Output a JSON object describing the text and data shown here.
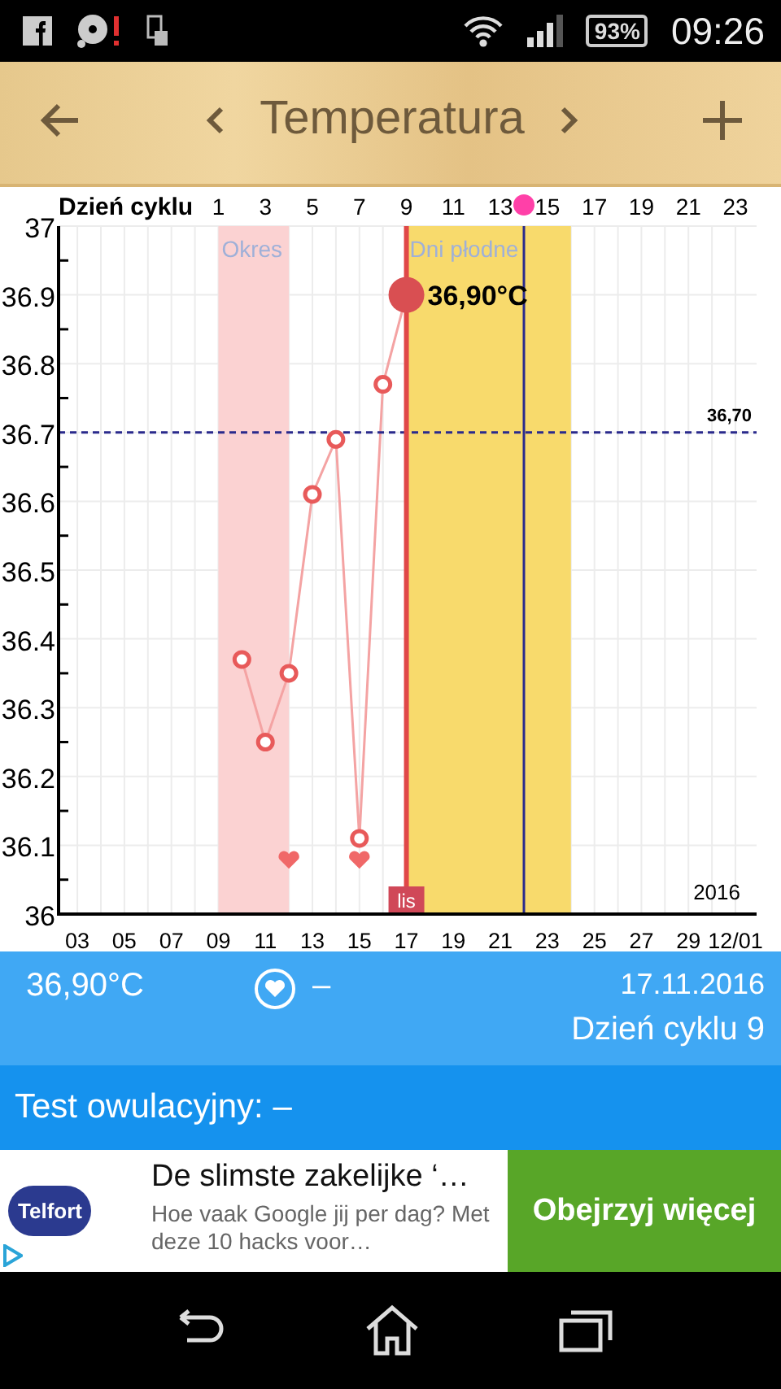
{
  "status_bar": {
    "battery": "93%",
    "time": "09:26"
  },
  "header": {
    "title": "Temperatura"
  },
  "chart": {
    "date_labels": [
      "03",
      "05",
      "07",
      "09",
      "11",
      "13",
      "15",
      "17",
      "19",
      "21",
      "23",
      "25",
      "27",
      "29",
      "12/01"
    ],
    "year_label": "2016",
    "chart_data": {
      "type": "line",
      "xlabel": "Dzień cyklu",
      "x": [
        2,
        3,
        4,
        5,
        6,
        7,
        8,
        9
      ],
      "series": [
        {
          "color": "#f4a3a3",
          "marker": "circle",
          "values": [
            36.37,
            36.25,
            36.35,
            36.61,
            36.69,
            36.11,
            36.77,
            36.9
          ]
        },
        {
          "type": "scatter",
          "color": "#f06868",
          "values": [
            null,
            null,
            36.08,
            null,
            null,
            36.08,
            null,
            null
          ]
        }
      ],
      "xlim": [
        -5.8,
        23.9
      ],
      "ylim": [
        36,
        37
      ],
      "grid": true,
      "xticks": [
        1,
        3,
        5,
        7,
        9,
        11,
        13,
        15,
        17,
        19,
        21,
        23
      ],
      "yticks": [
        {
          "value": 36,
          "label": "36"
        },
        {
          "value": 36.1,
          "label": "36.1"
        },
        {
          "value": 36.2,
          "label": "36.2"
        },
        {
          "value": 36.3,
          "label": "36.3"
        },
        {
          "value": 36.4,
          "label": "36.4"
        },
        {
          "value": 36.5,
          "label": "36.5"
        },
        {
          "value": 36.6,
          "label": "36.6"
        },
        {
          "value": 36.7,
          "label": "36.7"
        },
        {
          "value": 36.8,
          "label": "36.8"
        },
        {
          "value": 36.9,
          "label": "36.9"
        },
        {
          "value": 37,
          "label": "37"
        }
      ],
      "bands": [
        {
          "axis": "x",
          "from": 1,
          "to": 4,
          "label": "Okres",
          "color": "#fbd2d2"
        },
        {
          "axis": "x",
          "from": 9,
          "to": 16,
          "label": "Dni płodne",
          "color": "#f8da6c"
        }
      ],
      "ref_lines": [
        {
          "axis": "y",
          "value": 36.7,
          "label": "36,70",
          "color": "#2a2a8c"
        },
        {
          "axis": "x",
          "value": 14,
          "color": "#2a2a8c"
        },
        {
          "axis": "x",
          "value": 9,
          "color": "#e04848",
          "label": "lis"
        }
      ],
      "annotations": [
        {
          "x": 9,
          "y": 36.9,
          "text": "36,90°C"
        }
      ]
    }
  },
  "info": {
    "temperature": "36,90°C",
    "intercourse": "–",
    "date": "17.11.2016",
    "cycle_day": "Dzień cyklu 9"
  },
  "ovulation_test": "Test owulacyjny: –",
  "ad": {
    "logo": "Telfort",
    "title": "De slimste zakelijke ‘…",
    "body": "Hoe vaak Google jij per dag? Met deze 10 hacks voor…",
    "button": "Obejrzyj więcej"
  }
}
